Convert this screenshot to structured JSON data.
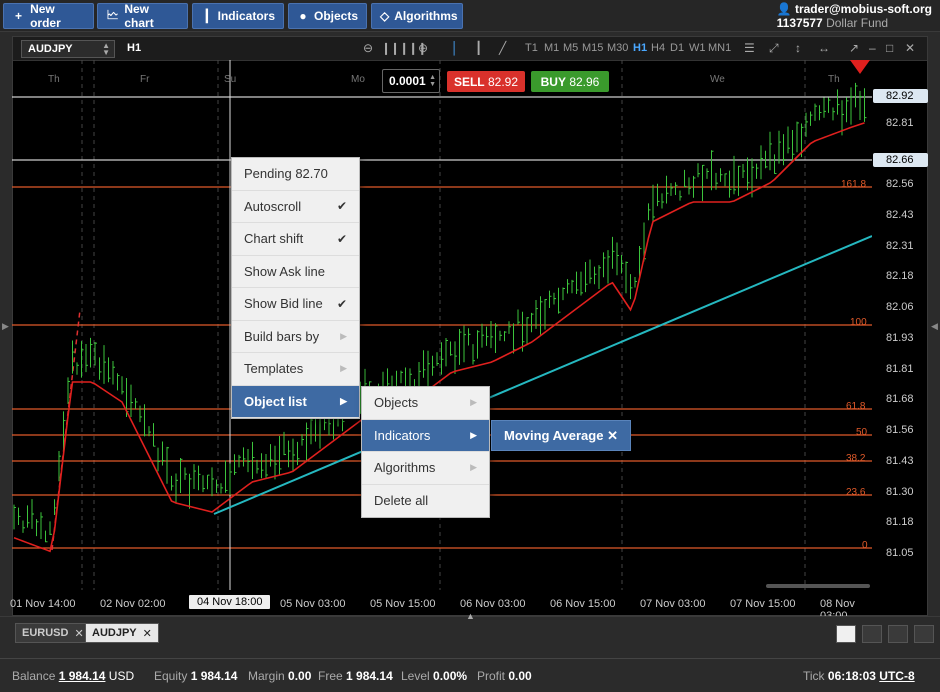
{
  "toolbar": {
    "new_order": "New order",
    "new_chart": "New chart",
    "indicators": "Indicators",
    "objects": "Objects",
    "algorithms": "Algorithms"
  },
  "account": {
    "email": "trader@mobius-soft.org",
    "number": "1137577",
    "fund": "Dollar Fund"
  },
  "chart_header": {
    "symbol": "AUDJPY",
    "timeframe": "H1",
    "timeframes": [
      "T1",
      "M1",
      "M5",
      "M15",
      "M30",
      "H1",
      "H4",
      "D1",
      "W1",
      "MN1"
    ],
    "active_timeframe": "H1"
  },
  "trade": {
    "lot": "0.0001",
    "sell_label": "SELL",
    "sell_price": "82.92",
    "buy_label": "BUY",
    "buy_price": "82.96",
    "sell_color": "#d9312b",
    "buy_color": "#3a9a2c"
  },
  "day_labels": [
    "Th",
    "Fr",
    "Su",
    "Mo",
    "We",
    "Th"
  ],
  "price_axis": [
    "82.81",
    "82.56",
    "82.43",
    "82.31",
    "82.18",
    "82.06",
    "81.93",
    "81.81",
    "81.68",
    "81.56",
    "81.43",
    "81.30",
    "81.18",
    "81.05"
  ],
  "price_boxes": {
    "ask": "82.92",
    "pending": "82.66"
  },
  "fib_levels": [
    "161.8",
    "100",
    "61.8",
    "50",
    "38.2",
    "23.6",
    "0"
  ],
  "time_axis": [
    "01 Nov 14:00",
    "02 Nov 02:00",
    "04 Nov 18:00",
    "05 Nov 03:00",
    "05 Nov 15:00",
    "06 Nov 03:00",
    "06 Nov 15:00",
    "07 Nov 03:00",
    "07 Nov 15:00",
    "08 Nov 03:00"
  ],
  "crosshair_time": "04 Nov 18:00",
  "context_menu": {
    "pending": "Pending 82.70",
    "items": [
      {
        "label": "Autoscroll",
        "checked": true
      },
      {
        "label": "Chart shift",
        "checked": true
      },
      {
        "label": "Show Ask line",
        "checked": false
      },
      {
        "label": "Show Bid line",
        "checked": true
      },
      {
        "label": "Build bars by",
        "submenu": true
      },
      {
        "label": "Templates",
        "submenu": true
      },
      {
        "label": "Object list",
        "submenu": true,
        "active": true
      }
    ]
  },
  "object_submenu": [
    "Objects",
    "Indicators",
    "Algorithms",
    "Delete all"
  ],
  "indicator_item": "Moving Average",
  "tabs": [
    "EURUSD",
    "AUDJPY"
  ],
  "status": {
    "balance_label": "Balance",
    "balance": "1 984.14",
    "currency": "USD",
    "equity_label": "Equity",
    "equity": "1 984.14",
    "margin_label": "Margin",
    "margin": "0.00",
    "free_label": "Free",
    "free": "1 984.14",
    "level_label": "Level",
    "level": "0.00%",
    "profit_label": "Profit",
    "profit": "0.00",
    "tick_label": "Tick",
    "tick_time": "06:18:03",
    "timezone": "UTC-8"
  }
}
